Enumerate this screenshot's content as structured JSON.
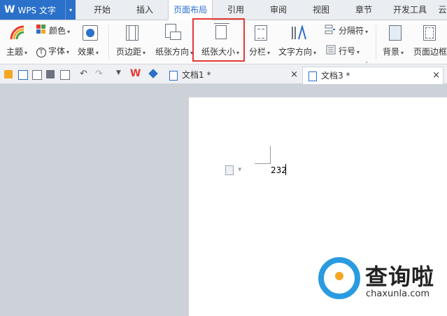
{
  "app": {
    "logo": "W",
    "name": "WPS 文字",
    "caret": "▾"
  },
  "menu": {
    "tabs": [
      {
        "label": "开始"
      },
      {
        "label": "插入"
      },
      {
        "label": "页面布局"
      },
      {
        "label": "引用"
      },
      {
        "label": "审阅"
      },
      {
        "label": "视图"
      },
      {
        "label": "章节"
      },
      {
        "label": "开发工具"
      },
      {
        "label": "云"
      }
    ],
    "active": "页面布局"
  },
  "ribbon": {
    "theme": "主题",
    "color": "颜色",
    "font": "字体",
    "effect": "效果",
    "margins": "页边距",
    "orientation": "纸张方向",
    "size": "纸张大小",
    "columns": "分栏",
    "text_direction": "文字方向",
    "breaks": "分隔符",
    "line_numbers": "行号",
    "background": "背景",
    "page_border": "页面边框",
    "caret": "▾"
  },
  "tabs": {
    "doc1": "文档1 *",
    "doc3": "文档3 *",
    "close": "×"
  },
  "document": {
    "text": "232"
  },
  "colors": {
    "accent": "#2b70c9",
    "highlight": "#e53935",
    "watermark_blue": "#2a9be0",
    "watermark_orange": "#f5a623"
  },
  "watermark": {
    "title": "查询啦",
    "url": "chaxunla.com"
  }
}
